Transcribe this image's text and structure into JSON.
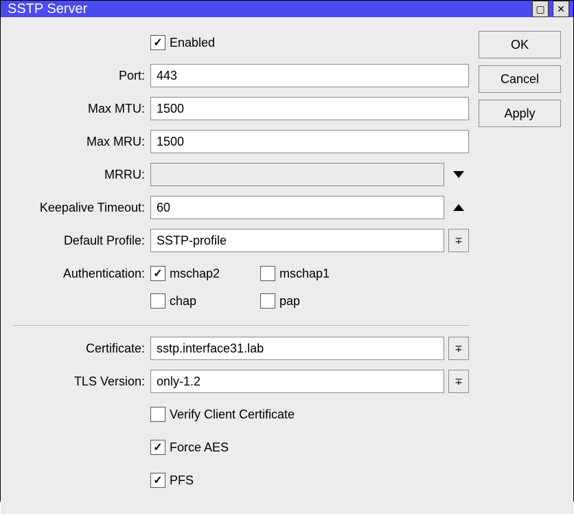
{
  "window": {
    "title": "SSTP Server"
  },
  "buttons": {
    "ok": "OK",
    "cancel": "Cancel",
    "apply": "Apply"
  },
  "labels": {
    "enabled": "Enabled",
    "port": "Port:",
    "max_mtu": "Max MTU:",
    "max_mru": "Max MRU:",
    "mrru": "MRRU:",
    "keepalive": "Keepalive Timeout:",
    "default_profile": "Default Profile:",
    "authentication": "Authentication:",
    "certificate": "Certificate:",
    "tls_version": "TLS Version:",
    "verify_client": "Verify Client Certificate",
    "force_aes": "Force AES",
    "pfs": "PFS",
    "mschap2": "mschap2",
    "mschap1": "mschap1",
    "chap": "chap",
    "pap": "pap"
  },
  "values": {
    "enabled": true,
    "port": "443",
    "max_mtu": "1500",
    "max_mru": "1500",
    "mrru": "",
    "keepalive": "60",
    "default_profile": "SSTP-profile",
    "mschap2": true,
    "mschap1": false,
    "chap": false,
    "pap": false,
    "certificate": "sstp.interface31.lab",
    "tls_version": "only-1.2",
    "verify_client": false,
    "force_aes": true,
    "pfs": true
  }
}
